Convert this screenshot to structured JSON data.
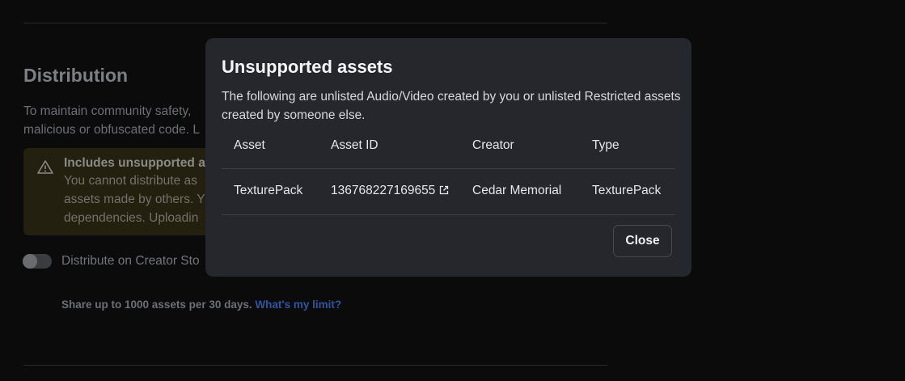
{
  "page": {
    "section_title": "Distribution",
    "section_desc_line1": "To maintain community safety,",
    "section_desc_line2": "malicious or obfuscated code. L",
    "warning": {
      "title": "Includes unsupported a",
      "line1": "You cannot distribute as",
      "line2": "assets made by others. Y",
      "line3": "dependencies. Uploadin"
    },
    "toggle_label": "Distribute on Creator Sto",
    "limit_text": "Share up to 1000 assets per 30 days.",
    "limit_link": "What's my limit?"
  },
  "modal": {
    "title": "Unsupported assets",
    "description": "The following are unlisted Audio/Video created by you or unlisted Restricted assets created by someone else.",
    "columns": [
      "Asset",
      "Asset ID",
      "Creator",
      "Type"
    ],
    "rows": [
      {
        "asset": "TexturePack",
        "asset_id": "136768227169655",
        "creator": "Cedar Memorial",
        "type": "TexturePack"
      }
    ],
    "close_label": "Close"
  },
  "colors": {
    "modal_bg": "#25272d",
    "page_bg": "#0b0b0c",
    "link": "#2c56a0"
  }
}
